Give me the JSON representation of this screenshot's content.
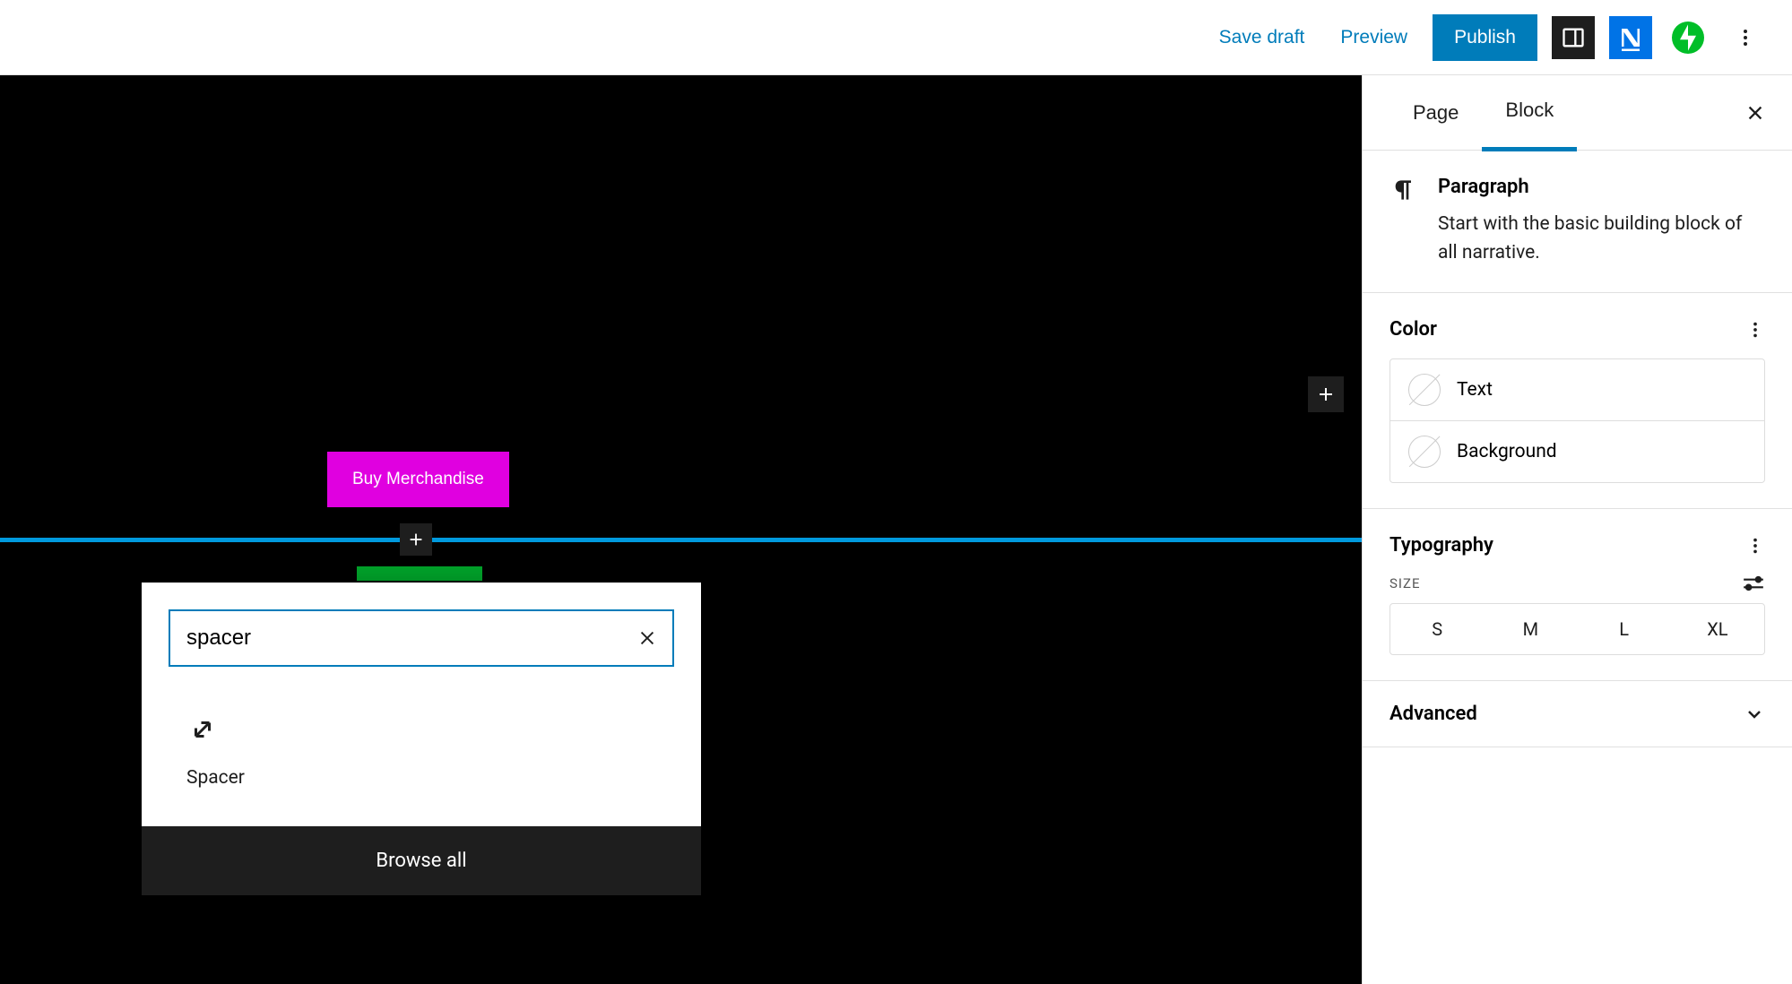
{
  "topbar": {
    "save_draft": "Save draft",
    "preview": "Preview",
    "publish": "Publish"
  },
  "canvas": {
    "buy_button": "Buy Merchandise"
  },
  "inserter": {
    "search_value": "spacer",
    "result_label": "Spacer",
    "browse_all": "Browse all"
  },
  "sidebar": {
    "tabs": {
      "page": "Page",
      "block": "Block"
    },
    "block_info": {
      "title": "Paragraph",
      "description": "Start with the basic building block of all narrative."
    },
    "color": {
      "panel_title": "Color",
      "text_label": "Text",
      "background_label": "Background"
    },
    "typography": {
      "panel_title": "Typography",
      "size_label": "SIZE",
      "sizes": [
        "S",
        "M",
        "L",
        "XL"
      ]
    },
    "advanced": {
      "title": "Advanced"
    }
  }
}
